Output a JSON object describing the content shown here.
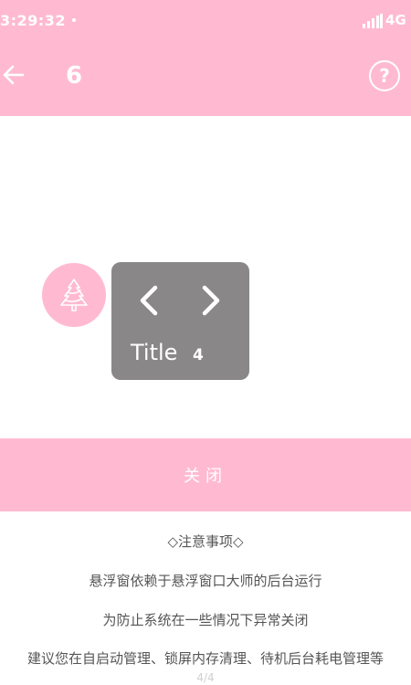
{
  "status_bar": {
    "time": "3:29:32",
    "network": "4G"
  },
  "app_bar": {
    "title": "6"
  },
  "help": {
    "symbol": "?"
  },
  "float_panel": {
    "title": "Title",
    "count": "4"
  },
  "close_label": "关闭",
  "notes": {
    "heading": "◇注意事项◇",
    "line1": "悬浮窗依赖于悬浮窗口大师的后台运行",
    "line2": "为防止系统在一些情况下异常关闭",
    "line3": "建议您在自启动管理、锁屏内存清理、待机后台耗电管理等"
  },
  "page_indicator": "4/4",
  "colors": {
    "accent_pink": "#ffbad2",
    "panel_gray": "#8a8789"
  }
}
